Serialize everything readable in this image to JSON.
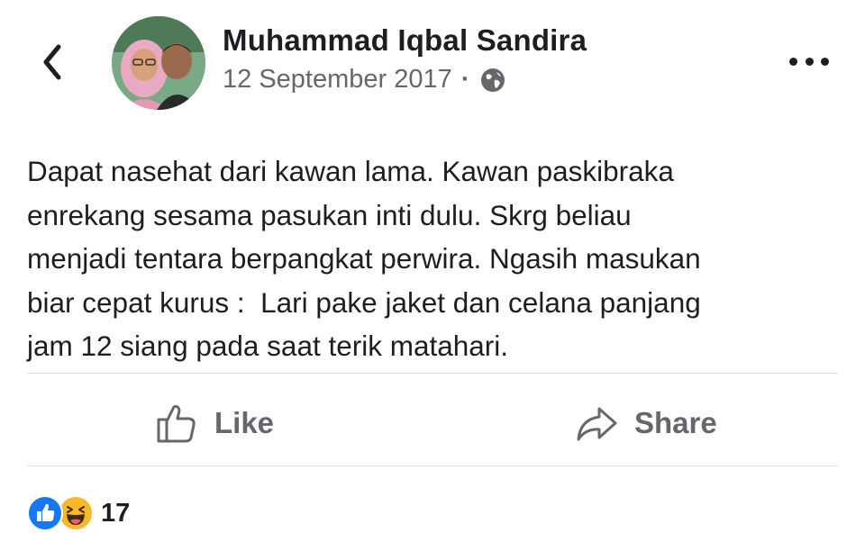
{
  "header": {
    "author_name": "Muhammad Iqbal Sandira",
    "date": "12 September 2017",
    "separator": "·",
    "audience_icon": "globe-icon",
    "back_icon": "chevron-left-icon",
    "more_icon": "more-horizontal-icon"
  },
  "post": {
    "text": "Dapat nasehat dari kawan lama. Kawan paskibraka\nenrekang sesama pasukan inti dulu. Skrg beliau\nmenjadi tentara berpangkat perwira. Ngasih masukan\nbiar cepat kurus :  Lari pake jaket dan celana panjang\njam 12 siang pada saat terik matahari."
  },
  "actions": {
    "like_label": "Like",
    "share_label": "Share"
  },
  "reactions": {
    "types": [
      "like",
      "haha"
    ],
    "count": "17"
  },
  "colors": {
    "text": "#1c1e21",
    "secondary": "#65676b",
    "like_blue": "#1877f2",
    "haha_yellow": "#f7b928",
    "divider": "#dadde1"
  }
}
